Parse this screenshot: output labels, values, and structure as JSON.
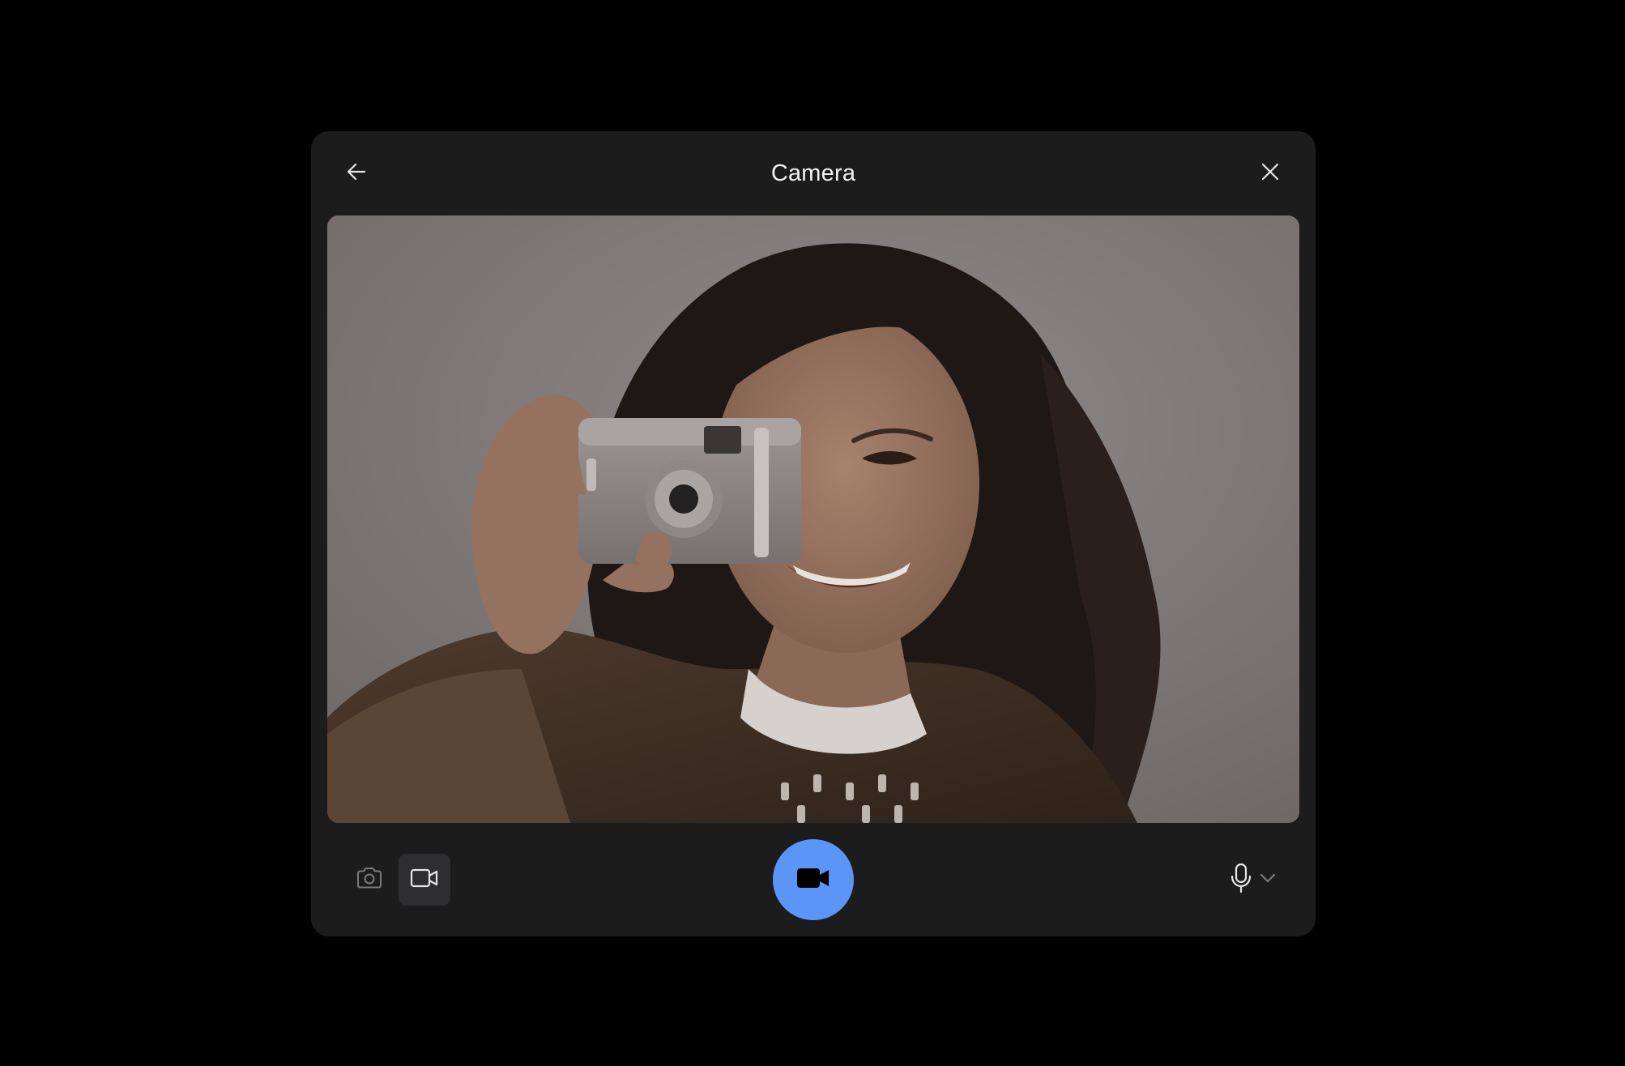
{
  "header": {
    "title": "Camera",
    "back_icon": "arrow-left-icon",
    "close_icon": "close-icon"
  },
  "preview": {
    "icon": "camera-preview"
  },
  "controls": {
    "photo_mode_icon": "camera-icon",
    "video_mode_icon": "video-icon",
    "active_mode": "video",
    "record_icon": "video-filled-icon",
    "mic_icon": "microphone-icon",
    "mic_dropdown_icon": "chevron-down-icon"
  },
  "colors": {
    "background": "#000000",
    "modal": "#1c1c1d",
    "accent": "#5b95f8",
    "text": "#f2f2f2",
    "icon": "#e6e6e6",
    "icon_muted": "#7a7a7c",
    "active_tile": "#2e2e30"
  }
}
